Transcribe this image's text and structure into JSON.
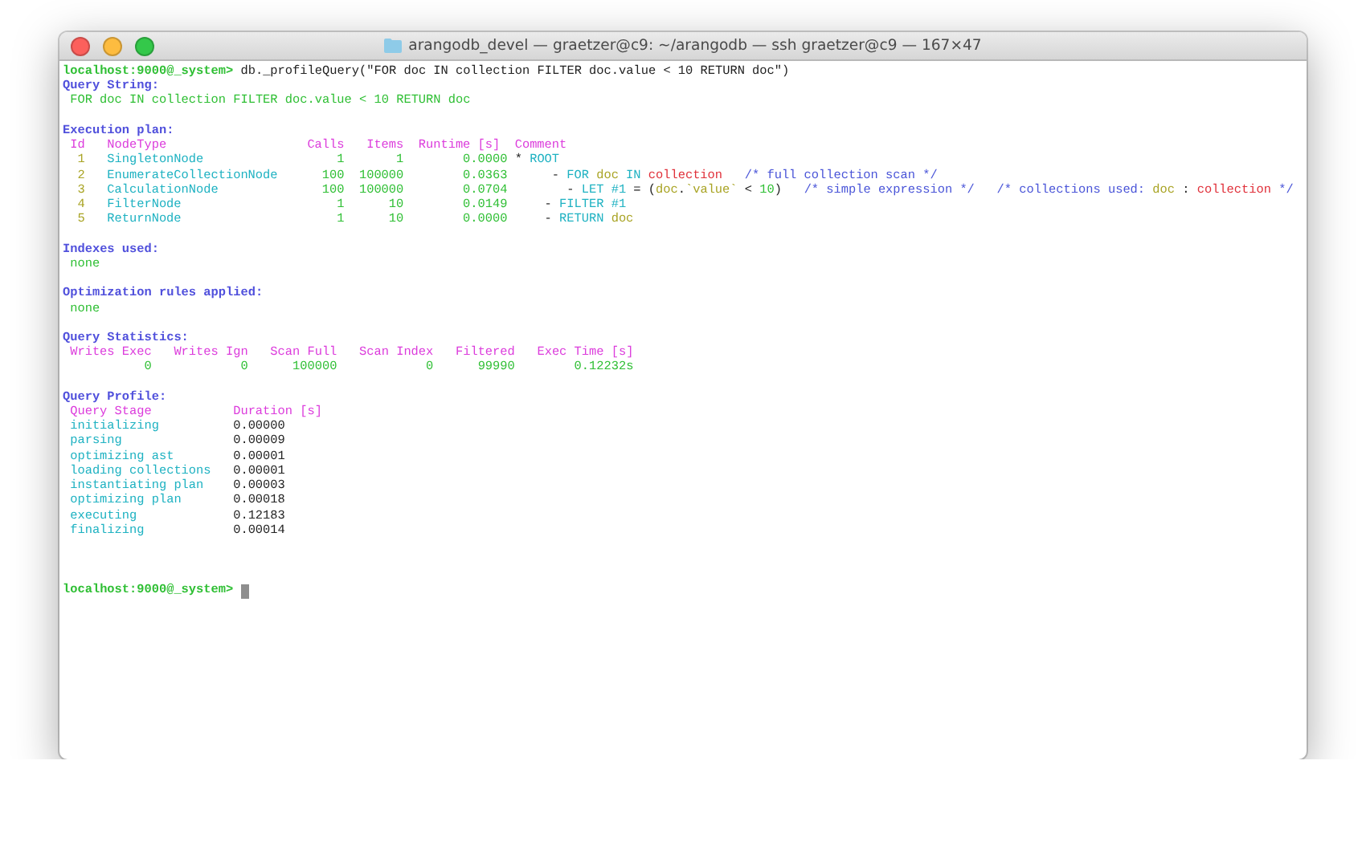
{
  "window": {
    "title": "arangodb_devel — graetzer@c9: ~/arangodb — ssh graetzer@c9 — 167×47"
  },
  "command": {
    "prompt": "localhost:9000@_system>",
    "text": "db._profileQuery(\"FOR doc IN collection FILTER doc.value < 10 RETURN doc\")"
  },
  "query_string": {
    "heading": "Query String:",
    "text": "FOR doc IN collection FILTER doc.value < 10 RETURN doc"
  },
  "execution_plan": {
    "heading": "Execution plan:",
    "columns": [
      "Id",
      "NodeType",
      "Calls",
      "Items",
      "Runtime [s]",
      "Comment"
    ],
    "rows": [
      {
        "id": "1",
        "node_type": "SingletonNode",
        "calls": "1",
        "items": "1",
        "runtime": "0.0000",
        "comment": [
          {
            "kind": "plain",
            "text": "* "
          },
          {
            "kind": "keyword",
            "text": "ROOT"
          }
        ]
      },
      {
        "id": "2",
        "node_type": "EnumerateCollectionNode",
        "calls": "100",
        "items": "100000",
        "runtime": "0.0363",
        "comment": [
          {
            "kind": "plain",
            "text": "     - "
          },
          {
            "kind": "keyword",
            "text": "FOR "
          },
          {
            "kind": "variable",
            "text": "doc "
          },
          {
            "kind": "keyword",
            "text": "IN "
          },
          {
            "kind": "collection",
            "text": "collection   "
          },
          {
            "kind": "comment",
            "text": "/* full collection scan */"
          }
        ]
      },
      {
        "id": "3",
        "node_type": "CalculationNode",
        "calls": "100",
        "items": "100000",
        "runtime": "0.0704",
        "comment": [
          {
            "kind": "plain",
            "text": "       - "
          },
          {
            "kind": "keyword",
            "text": "LET "
          },
          {
            "kind": "keyword",
            "text": "#1 "
          },
          {
            "kind": "plain",
            "text": "= ("
          },
          {
            "kind": "variable",
            "text": "doc"
          },
          {
            "kind": "plain",
            "text": "."
          },
          {
            "kind": "variable",
            "text": "`value`"
          },
          {
            "kind": "plain",
            "text": " < "
          },
          {
            "kind": "number",
            "text": "10"
          },
          {
            "kind": "plain",
            "text": ")   "
          },
          {
            "kind": "comment",
            "text": "/* simple expression */   "
          },
          {
            "kind": "comment",
            "text": "/* collections used: "
          },
          {
            "kind": "variable",
            "text": "doc"
          },
          {
            "kind": "plain",
            "text": " : "
          },
          {
            "kind": "collection",
            "text": "collection"
          },
          {
            "kind": "comment",
            "text": " */"
          }
        ]
      },
      {
        "id": "4",
        "node_type": "FilterNode",
        "calls": "1",
        "items": "10",
        "runtime": "0.0149",
        "comment": [
          {
            "kind": "plain",
            "text": "    - "
          },
          {
            "kind": "keyword",
            "text": "FILTER "
          },
          {
            "kind": "keyword",
            "text": "#1"
          }
        ]
      },
      {
        "id": "5",
        "node_type": "ReturnNode",
        "calls": "1",
        "items": "10",
        "runtime": "0.0000",
        "comment": [
          {
            "kind": "plain",
            "text": "    - "
          },
          {
            "kind": "keyword",
            "text": "RETURN "
          },
          {
            "kind": "variable",
            "text": "doc"
          }
        ]
      }
    ]
  },
  "indexes": {
    "heading": "Indexes used:",
    "value": "none"
  },
  "optimization": {
    "heading": "Optimization rules applied:",
    "value": "none"
  },
  "statistics": {
    "heading": "Query Statistics:",
    "columns": [
      "Writes Exec",
      "Writes Ign",
      "Scan Full",
      "Scan Index",
      "Filtered",
      "Exec Time [s]"
    ],
    "values": [
      "0",
      "0",
      "100000",
      "0",
      "99990",
      "0.12232s"
    ]
  },
  "profile": {
    "heading": "Query Profile:",
    "columns": [
      "Query Stage",
      "Duration [s]"
    ],
    "rows": [
      {
        "stage": "initializing",
        "duration": "0.00000"
      },
      {
        "stage": "parsing",
        "duration": "0.00009"
      },
      {
        "stage": "optimizing ast",
        "duration": "0.00001"
      },
      {
        "stage": "loading collections",
        "duration": "0.00001"
      },
      {
        "stage": "instantiating plan",
        "duration": "0.00003"
      },
      {
        "stage": "optimizing plan",
        "duration": "0.00018"
      },
      {
        "stage": "executing",
        "duration": "0.12183"
      },
      {
        "stage": "finalizing",
        "duration": "0.00014"
      }
    ]
  },
  "final_prompt": {
    "prompt": "localhost:9000@_system>"
  }
}
